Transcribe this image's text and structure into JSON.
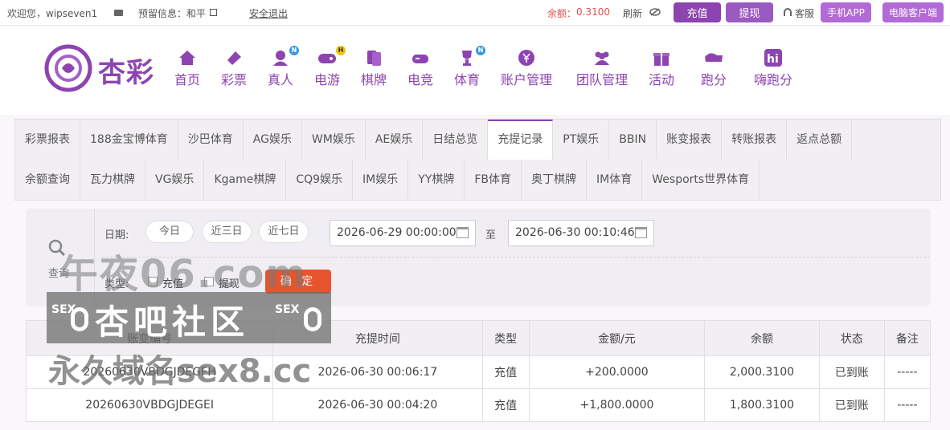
{
  "topbar": {
    "welcome": "欢迎您，wipseven1",
    "reserved": "预留信息：和平",
    "logout": "安全退出",
    "balance_label": "余额：",
    "balance_value": "0.3100",
    "refresh": "刷新",
    "deposit": "充值",
    "withdraw": "提现",
    "service": "客服",
    "mobile_app": "手机APP",
    "pc_client": "电脑客户端"
  },
  "logo": {
    "text": "杏彩"
  },
  "nav": [
    {
      "label": "首页",
      "icon": "home-icon"
    },
    {
      "label": "彩票",
      "icon": "ticket-icon"
    },
    {
      "label": "真人",
      "icon": "dealer-icon",
      "badge": "N"
    },
    {
      "label": "电游",
      "icon": "gamepad-icon",
      "badge": "H"
    },
    {
      "label": "棋牌",
      "icon": "cards-icon"
    },
    {
      "label": "电竞",
      "icon": "controller-icon"
    },
    {
      "label": "体育",
      "icon": "trophy-icon",
      "badge": "N"
    },
    {
      "label": "账户管理",
      "icon": "yen-icon"
    },
    {
      "label": "团队管理",
      "icon": "team-icon"
    },
    {
      "label": "活动",
      "icon": "gift-icon"
    },
    {
      "label": "跑分",
      "icon": "runner-icon"
    },
    {
      "label": "嗨跑分",
      "icon": "hi-icon"
    }
  ],
  "tabs_row1": [
    "彩票报表",
    "188金宝博体育",
    "沙巴体育",
    "AG娱乐",
    "WM娱乐",
    "AE娱乐",
    "日结总览",
    "充提记录",
    "PT娱乐",
    "BBIN",
    "账变报表",
    "转账报表",
    "返点总额"
  ],
  "tabs_row2": [
    "余额查询",
    "瓦力棋牌",
    "VG娱乐",
    "Kgame棋牌",
    "CQ9娱乐",
    "IM娱乐",
    "YY棋牌",
    "FB体育",
    "奥丁棋牌",
    "IM体育",
    "Wesports世界体育"
  ],
  "active_tab": "充提记录",
  "filter": {
    "query_label": "查询",
    "date_label": "日期:",
    "today": "今日",
    "last3": "近三日",
    "last7": "近七日",
    "start": "2026-06-29 00:00:00",
    "to": "至",
    "end": "2026-06-30 00:10:46",
    "type_label": "类型:",
    "type_deposit": "充值",
    "type_withdraw": "提现",
    "confirm": "确 定"
  },
  "table": {
    "headers": [
      "账变编号",
      "充提时间",
      "类型",
      "金额/元",
      "余额",
      "状态",
      "备注"
    ],
    "rows": [
      [
        "20260630VBDGJDEGFH",
        "2026-06-30 00:06:17",
        "充值",
        "+200.0000",
        "2,000.3100",
        "已到账",
        "-----"
      ],
      [
        "20260630VBDGJDEGEI",
        "2026-06-30 00:04:20",
        "充值",
        "+1,800.0000",
        "1,800.3100",
        "已到账",
        "-----"
      ]
    ]
  },
  "watermark": {
    "line1": "午夜06.com",
    "line2": "杏吧社区",
    "sex": "SEX",
    "line3": "永久域名sex8.cc"
  },
  "colors": {
    "brand": "#8d44b0",
    "amount": "#e03b3b",
    "success": "#2e9c2e",
    "confirm": "#e8542e"
  }
}
